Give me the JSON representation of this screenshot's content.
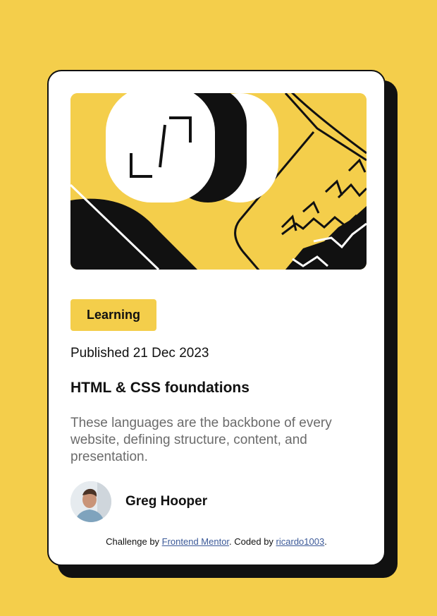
{
  "card": {
    "tag": "Learning",
    "published": "Published 21 Dec 2023",
    "title": "HTML & CSS foundations",
    "description": "These languages are the backbone of every website, defining structure, content, and presentation.",
    "author": {
      "name": "Greg Hooper",
      "avatar_icon": "avatar-photo-icon"
    }
  },
  "attribution": {
    "prefix": "Challenge by ",
    "link1": "Frontend Mentor",
    "middle": ". Coded by ",
    "link2": "ricardo1003",
    "suffix": "."
  },
  "colors": {
    "background": "#f4ce4b",
    "card": "#ffffff",
    "ink": "#111111",
    "muted": "#6b6b6b",
    "link": "#3b5998"
  },
  "icons": {
    "illustration": "abstract-illustration-icon"
  }
}
